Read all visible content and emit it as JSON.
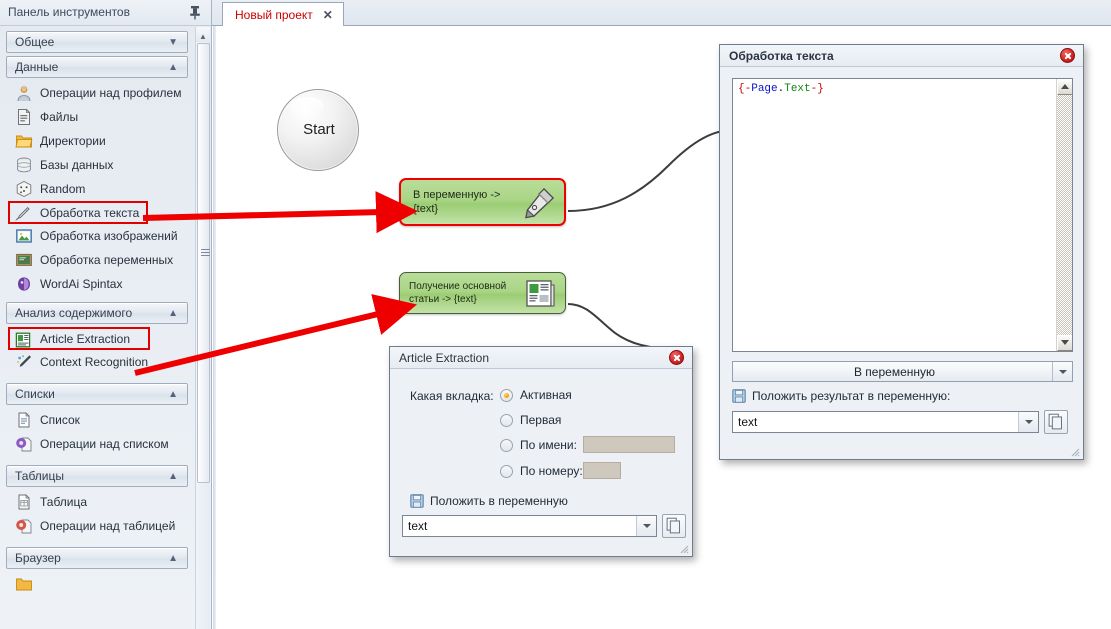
{
  "toolpanel": {
    "title": "Панель инструментов",
    "pin_icon": "pin-icon",
    "groups": [
      {
        "label": "Общее",
        "state": "collapsed",
        "chevron": "chevron-down-icon",
        "items": []
      },
      {
        "label": "Данные",
        "state": "expanded",
        "chevron": "chevron-up-icon",
        "items": [
          {
            "label": "Операции над профилем",
            "icon": "profile-icon",
            "highlighted": false
          },
          {
            "label": "Файлы",
            "icon": "file-icon",
            "highlighted": false
          },
          {
            "label": "Директории",
            "icon": "folder-icon",
            "highlighted": false
          },
          {
            "label": "Базы данных",
            "icon": "database-icon",
            "highlighted": false
          },
          {
            "label": "Random",
            "icon": "dice-icon",
            "highlighted": false
          },
          {
            "label": "Обработка текста",
            "icon": "pen-icon",
            "highlighted": true
          },
          {
            "label": "Обработка изображений",
            "icon": "image-icon",
            "highlighted": false
          },
          {
            "label": "Обработка переменных",
            "icon": "chalkboard-icon",
            "highlighted": false
          },
          {
            "label": "WordAi Spintax",
            "icon": "wordai-icon",
            "highlighted": false
          }
        ]
      },
      {
        "label": "Анализ содержимого",
        "state": "expanded",
        "chevron": "chevron-up-icon",
        "items": [
          {
            "label": "Article Extraction",
            "icon": "article-icon",
            "highlighted": true
          },
          {
            "label": "Context Recognition",
            "icon": "context-icon",
            "highlighted": false
          }
        ]
      },
      {
        "label": "Списки",
        "state": "expanded",
        "chevron": "chevron-up-icon",
        "items": [
          {
            "label": "Список",
            "icon": "list-icon",
            "highlighted": false
          },
          {
            "label": "Операции над списком",
            "icon": "list-ops-icon",
            "highlighted": false
          }
        ]
      },
      {
        "label": "Таблицы",
        "state": "expanded",
        "chevron": "chevron-up-icon",
        "items": [
          {
            "label": "Таблица",
            "icon": "table-icon",
            "highlighted": false
          },
          {
            "label": "Операции над таблицей",
            "icon": "table-ops-icon",
            "highlighted": false
          }
        ]
      },
      {
        "label": "Браузер",
        "state": "expanded",
        "chevron": "chevron-up-icon",
        "items": []
      }
    ]
  },
  "tabs": {
    "active": {
      "label": "Новый проект",
      "close_icon": "close-icon"
    }
  },
  "canvas": {
    "nodes": [
      {
        "id": "start",
        "label": "Start",
        "shape": "circle"
      },
      {
        "id": "text_node",
        "line1": "В переменную ->",
        "line2": "{text}",
        "icon": "pen-nib-icon",
        "selected": true
      },
      {
        "id": "article_node",
        "line1": "Получение основной",
        "line2": "статьи -> {text}",
        "icon": "newspaper-icon",
        "selected": false
      }
    ]
  },
  "dialog_text": {
    "title": "Обработка текста",
    "close_icon": "close-icon",
    "code": {
      "open_brace": "{",
      "dash1": "-",
      "namespace": "Page",
      "dot": ".",
      "property": "Text",
      "dash2": "-",
      "close_brace": "}"
    },
    "code_plain": "{-Page.Text-}",
    "action_combo": {
      "value": "В переменную",
      "arrow_icon": "chevron-down-icon"
    },
    "put_checkbox": {
      "label": "Положить результат в переменную:",
      "icon": "disk-icon",
      "checked": true
    },
    "variable_field": {
      "value": "text",
      "arrow_icon": "chevron-down-icon"
    },
    "copy_button": {
      "icon": "copy-icon"
    },
    "scroll_up_icon": "scroll-up-icon",
    "scroll_down_icon": "scroll-down-icon",
    "resize_grip": "resize-grip-icon"
  },
  "dialog_article": {
    "title": "Article Extraction",
    "close_icon": "close-icon",
    "tab_question_label": "Какая вкладка:",
    "radios": [
      {
        "label": "Активная",
        "selected": true,
        "has_field": false,
        "field_value": ""
      },
      {
        "label": "Первая",
        "selected": false,
        "has_field": false,
        "field_value": ""
      },
      {
        "label": "По имени:",
        "selected": false,
        "has_field": true,
        "field_value": ""
      },
      {
        "label": "По номеру:",
        "selected": false,
        "has_field": true,
        "field_value": ""
      }
    ],
    "put_checkbox": {
      "label": "Положить в переменную",
      "icon": "disk-icon",
      "checked": true
    },
    "variable_field": {
      "value": "text",
      "arrow_icon": "chevron-down-icon"
    },
    "copy_button": {
      "icon": "copy-icon"
    },
    "resize_grip": "resize-grip-icon"
  },
  "annotations": {
    "arrow_color": "#ee0000",
    "arrows": [
      {
        "from": "sidebar-item-обработка-текста",
        "to": "text_node"
      },
      {
        "from": "sidebar-item-article-extraction",
        "to": "article_node"
      }
    ]
  },
  "colors": {
    "accent_red": "#cc0000",
    "node_green": "#a9d585",
    "selection_red": "#ee0000",
    "panel_bg": "#e8edf3",
    "dialog_bg": "#edf1f6",
    "radio_selected": "#f5a300"
  }
}
